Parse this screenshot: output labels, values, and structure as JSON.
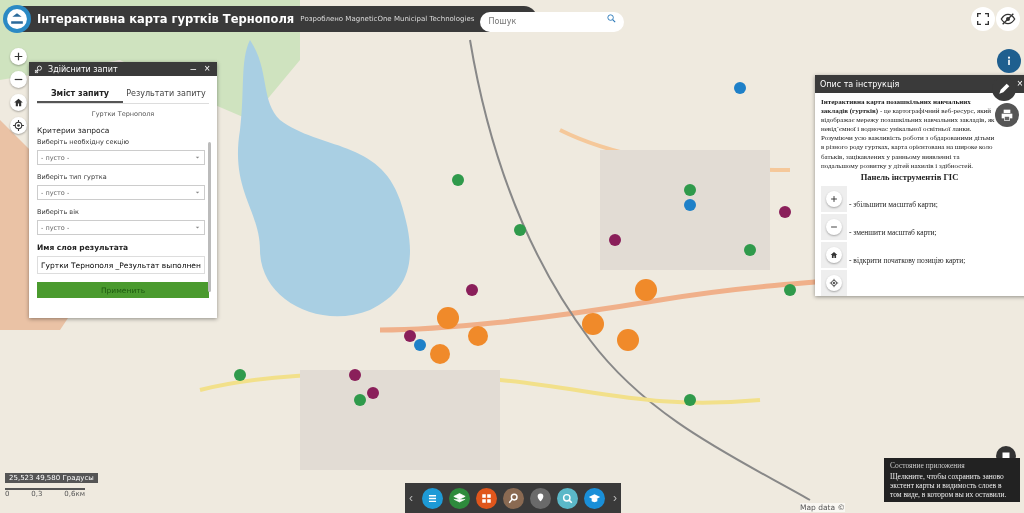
{
  "header": {
    "title": "Інтерактивна карта гуртків Тернополя",
    "subtitle": "Розроблено MagneticOne Municipal Technologies",
    "search": {
      "placeholder": "Пошук"
    }
  },
  "query_panel": {
    "title": "Здійснити запит",
    "minimize": "–",
    "close": "×",
    "tabs": [
      {
        "label": "Зміст запиту",
        "selected": true
      },
      {
        "label": "Результати запиту",
        "selected": false
      }
    ],
    "layer": "Гуртки Тернополя",
    "criteria_title": "Критерии запроса",
    "fields": [
      {
        "label": "Виберіть необхідну секцію",
        "value": "- пусто -"
      },
      {
        "label": "Виберіть тип гуртка",
        "value": "- пусто -"
      },
      {
        "label": "Виберіть вік",
        "value": "- пусто -"
      }
    ],
    "result_label": "Имя слоя результата",
    "result_value": "Гуртки Тернополя _Результат выполнен",
    "apply": "Применить"
  },
  "info_panel": {
    "title": "Опис та інструкція",
    "intro": "**Інтерактивна карта позашкільних навчальних закладів (гуртків)** -  це картографічний веб-ресурс, який відображає мережу позашкільних навчальних закладів, як невід`ємної і водночас унікальної освітньої ланки.",
    "text": "Розуміючи усю важливість роботи з обдарованими дітьми в різного роду гуртках, карта орієнтована на широке коло батьків, зацікавлених у ранньому виявленні та подальшому розвитку у дітей нахилів і здібностей.",
    "heading": "Панель інструментів ГІС",
    "tools": [
      {
        "kind": "zoom-in",
        "text": "- збільшити масштаб карти;"
      },
      {
        "kind": "zoom-out",
        "text": "- зменшити масштаб карти;"
      },
      {
        "kind": "home",
        "text": "- відкрити початкову позицію карти;"
      },
      {
        "kind": "locate"
      }
    ],
    "close": "×"
  },
  "coordinates": "25,523 49,580 Градусы",
  "scale": [
    "0",
    "0,3",
    "0,6км"
  ],
  "toolbar_arrows": {
    "previous": "‹",
    "next": "›"
  },
  "toolbar": [
    {
      "kind": "list",
      "color": "#1e9ad6"
    },
    {
      "kind": "layers",
      "color": "#2e8b3c"
    },
    {
      "kind": "grid",
      "color": "#e0561c"
    },
    {
      "kind": "query",
      "color": "#8a6a52"
    },
    {
      "kind": "pin",
      "color": "#6a6a6a"
    },
    {
      "kind": "search",
      "color": "#5bb8c8"
    },
    {
      "kind": "cap",
      "color": "#1a8fd8"
    }
  ],
  "status_popup": {
    "title": "Состояние приложения",
    "text": "Щелкните, чтобы сохранить заново экстент карты и видимость слоев в том виде, в котором вы их оставили."
  },
  "attribution": "Map data ©"
}
